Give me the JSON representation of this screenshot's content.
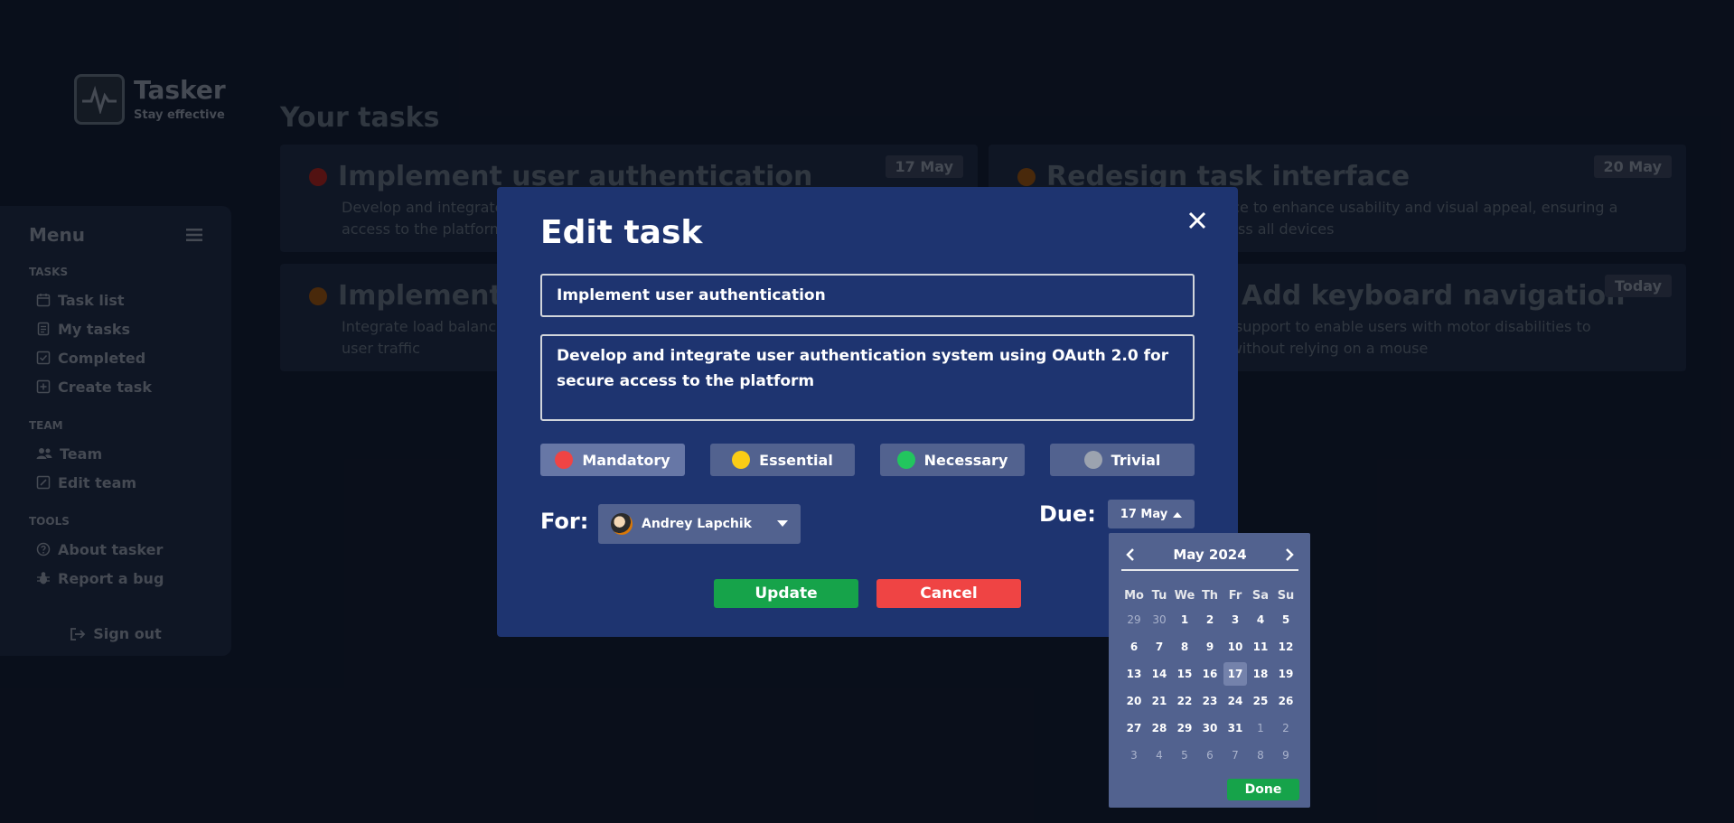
{
  "app": {
    "name": "Tasker",
    "tagline": "Stay effective"
  },
  "sidebar": {
    "title": "Menu",
    "sections": [
      {
        "label": "TASKS",
        "items": [
          "Task list",
          "My tasks",
          "Completed",
          "Create task"
        ]
      },
      {
        "label": "TEAM",
        "items": [
          "Team",
          "Edit team"
        ]
      },
      {
        "label": "TOOLS",
        "items": [
          "About tasker",
          "Report a bug"
        ]
      }
    ],
    "signout": "Sign out"
  },
  "main": {
    "title": "Your tasks",
    "tasks": [
      {
        "title": "Implement user authentication",
        "desc": "Develop and integrate user authentication system using OAuth 2.0 for secure access to the platform",
        "date": "17 May",
        "color": "#ef4444"
      },
      {
        "title": "Redesign task interface",
        "desc": "Redesign the task interface to enhance usability and visual appeal, ensuring a seamless experience across all devices",
        "date": "20 May",
        "color": "#eab308"
      },
      {
        "title": "Implement scalable backend",
        "desc": "Integrate load balancing and auto scaling so the platform can handle increased user traffic",
        "date": "",
        "color": "#eab308"
      },
      {
        "title": "Add keyboard navigation",
        "desc": "Add keyboard navigation support to enable users with motor disabilities to navigate the application without relying on a mouse",
        "date": "Today",
        "color": "#eab308"
      }
    ]
  },
  "modal": {
    "title": "Edit task",
    "task_title": "Implement user authentication",
    "task_desc": "Develop and integrate user authentication system using OAuth 2.0 for secure access to the platform",
    "priorities": [
      {
        "label": "Mandatory",
        "color": "#ef4444",
        "active": true
      },
      {
        "label": "Essential",
        "color": "#facc15",
        "active": false
      },
      {
        "label": "Necessary",
        "color": "#22c55e",
        "active": false
      },
      {
        "label": "Trivial",
        "color": "#9ca3af",
        "active": false
      }
    ],
    "for_label": "For:",
    "assignee": "Andrey Lapchik",
    "due_label": "Due:",
    "due_value": "17 May",
    "update": "Update",
    "cancel": "Cancel"
  },
  "datepicker": {
    "month": "May 2024",
    "weekdays": [
      "Mo",
      "Tu",
      "We",
      "Th",
      "Fr",
      "Sa",
      "Su"
    ],
    "days": [
      {
        "d": "29",
        "m": true
      },
      {
        "d": "30",
        "m": true
      },
      {
        "d": "1"
      },
      {
        "d": "2"
      },
      {
        "d": "3"
      },
      {
        "d": "4"
      },
      {
        "d": "5"
      },
      {
        "d": "6"
      },
      {
        "d": "7"
      },
      {
        "d": "8"
      },
      {
        "d": "9"
      },
      {
        "d": "10"
      },
      {
        "d": "11"
      },
      {
        "d": "12"
      },
      {
        "d": "13"
      },
      {
        "d": "14"
      },
      {
        "d": "15"
      },
      {
        "d": "16"
      },
      {
        "d": "17",
        "s": true
      },
      {
        "d": "18"
      },
      {
        "d": "19"
      },
      {
        "d": "20"
      },
      {
        "d": "21"
      },
      {
        "d": "22"
      },
      {
        "d": "23"
      },
      {
        "d": "24"
      },
      {
        "d": "25"
      },
      {
        "d": "26"
      },
      {
        "d": "27"
      },
      {
        "d": "28"
      },
      {
        "d": "29"
      },
      {
        "d": "30"
      },
      {
        "d": "31"
      },
      {
        "d": "1",
        "m": true
      },
      {
        "d": "2",
        "m": true
      },
      {
        "d": "3",
        "m": true
      },
      {
        "d": "4",
        "m": true
      },
      {
        "d": "5",
        "m": true
      },
      {
        "d": "6",
        "m": true
      },
      {
        "d": "7",
        "m": true
      },
      {
        "d": "8",
        "m": true
      },
      {
        "d": "9",
        "m": true
      }
    ],
    "done": "Done"
  }
}
